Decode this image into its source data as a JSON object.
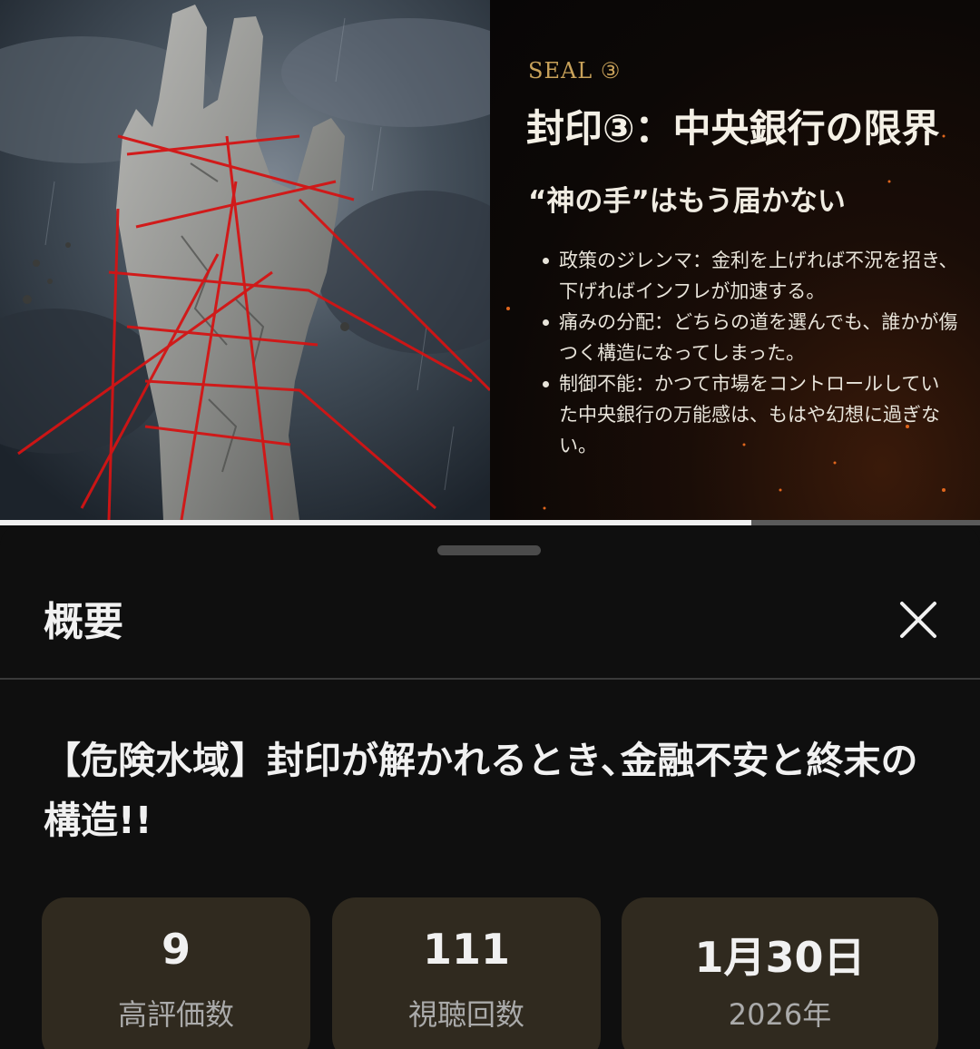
{
  "video": {
    "seal_tag": "SEAL ③",
    "slide_title": "封印③：中央銀行の限界",
    "slide_subtitle": "“神の手”はもう届かない",
    "bullets": [
      "政策のジレンマ：金利を上げれば不況を招き、下げればインフレが加速する。",
      "痛みの分配：どちらの道を選んでも、誰かが傷つく構造になってしまった。",
      "制御不能：かつて市場をコントロールしていた中央銀行の万能感は、もはや幻想に過ぎない。"
    ],
    "progress_fraction": 0.767
  },
  "sheet": {
    "title": "概要",
    "close_icon": "close-icon",
    "video_title": "【危険水域】封印が解かれるとき､金融不安と終末の構造!!",
    "stats": [
      {
        "value": "9",
        "label": "高評価数"
      },
      {
        "value": "111",
        "label": "視聴回数"
      },
      {
        "value": "1月30日",
        "label": "2026年"
      }
    ]
  },
  "colors": {
    "background": "#0f0f0f",
    "card": "#302a1f",
    "accent_gold": "#c9a25a",
    "thread_red": "#d41414"
  }
}
